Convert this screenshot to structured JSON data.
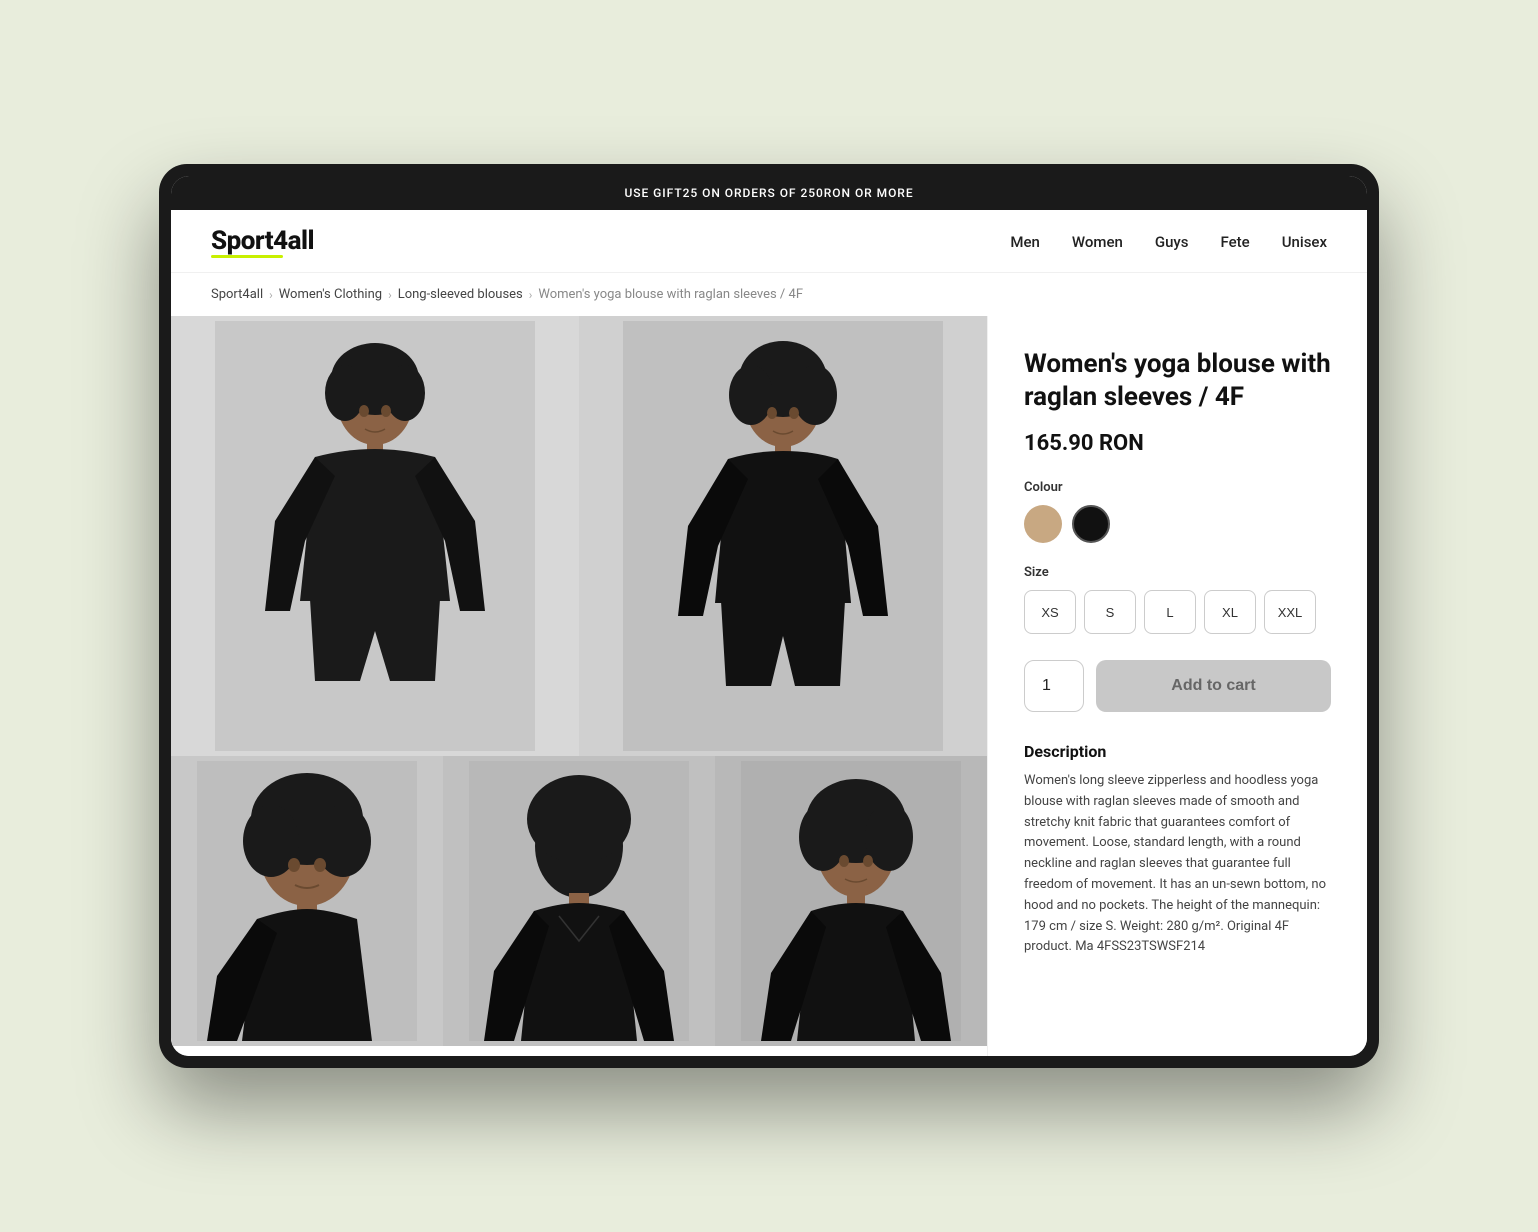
{
  "promo": {
    "text": "USE GIFT25 ON ORDERS OF 250RON OR MORE"
  },
  "header": {
    "logo": "Sport4all",
    "nav": [
      {
        "label": "Men",
        "href": "#"
      },
      {
        "label": "Women",
        "href": "#"
      },
      {
        "label": "Guys",
        "href": "#"
      },
      {
        "label": "Fete",
        "href": "#"
      },
      {
        "label": "Unisex",
        "href": "#"
      }
    ]
  },
  "breadcrumb": {
    "items": [
      {
        "label": "Sport4all",
        "href": "#"
      },
      {
        "label": "Women's Clothing",
        "href": "#"
      },
      {
        "label": "Long-sleeved blouses",
        "href": "#"
      },
      {
        "label": "Women's yoga blouse with raglan sleeves / 4F",
        "href": null
      }
    ]
  },
  "product": {
    "title": "Women's yoga blouse with raglan sleeves / 4F",
    "price": "165.90 RON",
    "colour_label": "Colour",
    "colours": [
      {
        "name": "tan",
        "class": "tan"
      },
      {
        "name": "black",
        "class": "black"
      }
    ],
    "size_label": "Size",
    "sizes": [
      "XS",
      "S",
      "L",
      "XL",
      "XXL"
    ],
    "quantity": "1",
    "add_to_cart": "Add to cart",
    "description_title": "Description",
    "description_text": "Women's long sleeve zipperless and hoodless yoga blouse with raglan sleeves made of smooth and stretchy knit fabric that guarantees comfort of movement. Loose, standard length, with a round neckline and raglan sleeves that guarantee full freedom of movement. It has an un-sewn bottom, no hood and no pockets. The height of the mannequin: 179 cm / size S. Weight: 280 g/m². Original 4F product. Ma 4FSS23TSWSF214"
  }
}
